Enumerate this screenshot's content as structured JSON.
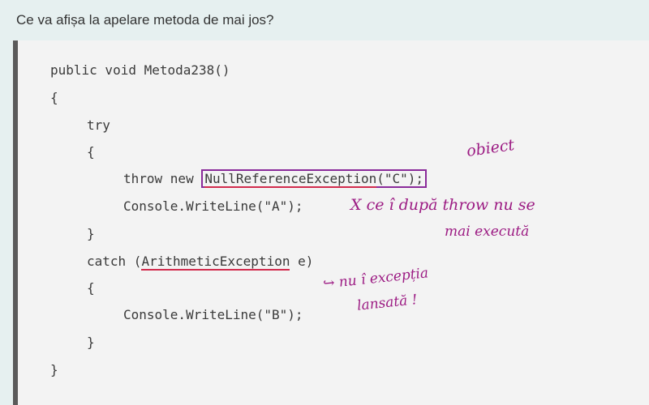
{
  "question": "Ce va afișa la apelare metoda de mai jos?",
  "code": {
    "l1": "public void Metoda238()",
    "l2": "{",
    "l3": "try",
    "l4": "{",
    "l5_pre": "throw new ",
    "l5_box_class": "NullReferenceException",
    "l5_box_rest": "(\"C\");",
    "l6": "Console.WriteLine(\"A\");",
    "l7": "}",
    "l8_pre": "catch (",
    "l8_ul": "ArithmeticException",
    "l8_post": " e)",
    "l9": "{",
    "l10": "Console.WriteLine(\"B\");",
    "l11": "}",
    "l12": "}"
  },
  "annotations": {
    "obiect": "obiect",
    "x_note_line1": "X ce î după throw nu se",
    "x_note_line2": "mai execută",
    "exc_note_line1": "↪ nu î excepția",
    "exc_note_line2": "lansată !"
  },
  "colors": {
    "ink": "#9c1b83",
    "underline": "#d22b4d",
    "box": "#8a2a9a"
  }
}
